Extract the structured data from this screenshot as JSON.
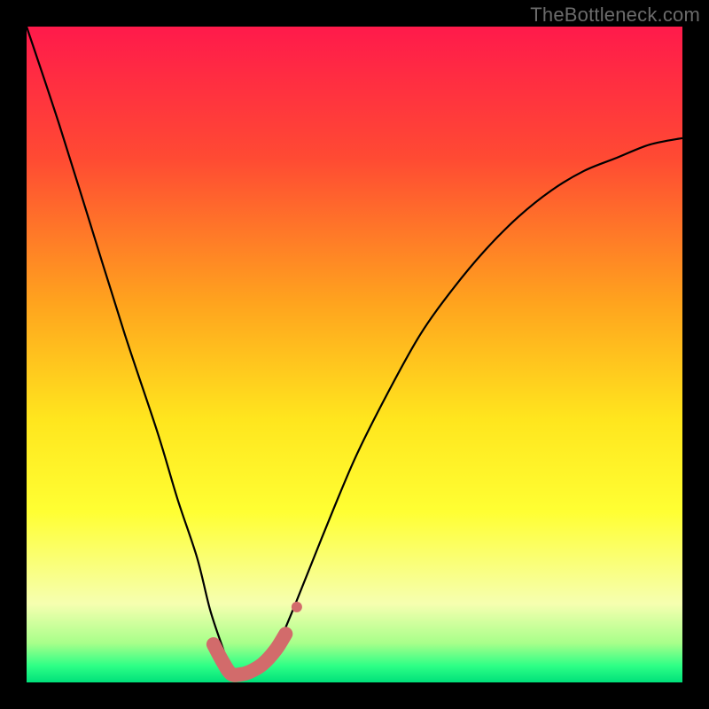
{
  "watermark": "TheBottleneck.com",
  "chart_data": {
    "type": "line",
    "title": "",
    "xlabel": "",
    "ylabel": "",
    "xlim": [
      0,
      100
    ],
    "ylim": [
      0,
      100
    ],
    "grid": false,
    "legend": false,
    "gradient_stops": [
      {
        "offset": 0,
        "color": "#ff1a4b"
      },
      {
        "offset": 0.2,
        "color": "#ff4a33"
      },
      {
        "offset": 0.42,
        "color": "#ffa31e"
      },
      {
        "offset": 0.6,
        "color": "#ffe61e"
      },
      {
        "offset": 0.74,
        "color": "#ffff33"
      },
      {
        "offset": 0.88,
        "color": "#f6ffb0"
      },
      {
        "offset": 0.94,
        "color": "#a8ff8a"
      },
      {
        "offset": 0.975,
        "color": "#2dff86"
      },
      {
        "offset": 1.0,
        "color": "#00e07a"
      }
    ],
    "series": [
      {
        "name": "bottleneck-curve",
        "color": "#000000",
        "x": [
          0,
          5,
          10,
          15,
          20,
          23,
          26,
          28,
          30,
          31,
          32,
          33,
          36,
          38,
          41,
          45,
          50,
          55,
          60,
          65,
          70,
          75,
          80,
          85,
          90,
          95,
          100
        ],
        "y": [
          100,
          85,
          69,
          53,
          38,
          28,
          19,
          11,
          5,
          2,
          0.5,
          0.5,
          2,
          5,
          12,
          22,
          34,
          44,
          53,
          60,
          66,
          71,
          75,
          78,
          80,
          82,
          83
        ]
      }
    ],
    "highlight_segment": {
      "name": "valley-highlight",
      "color": "#d26b6b",
      "linewidth": 16,
      "cap": "round",
      "x": [
        28.5,
        30.0,
        31.2,
        32.5,
        34.0,
        36.0,
        38.0,
        39.5
      ],
      "y": [
        5.8,
        3.0,
        1.3,
        1.2,
        1.6,
        2.8,
        5.0,
        7.4
      ]
    },
    "highlight_dot": {
      "name": "highlight-dot",
      "color": "#d26b6b",
      "radius": 6,
      "x": 41.2,
      "y": 11.5
    }
  }
}
